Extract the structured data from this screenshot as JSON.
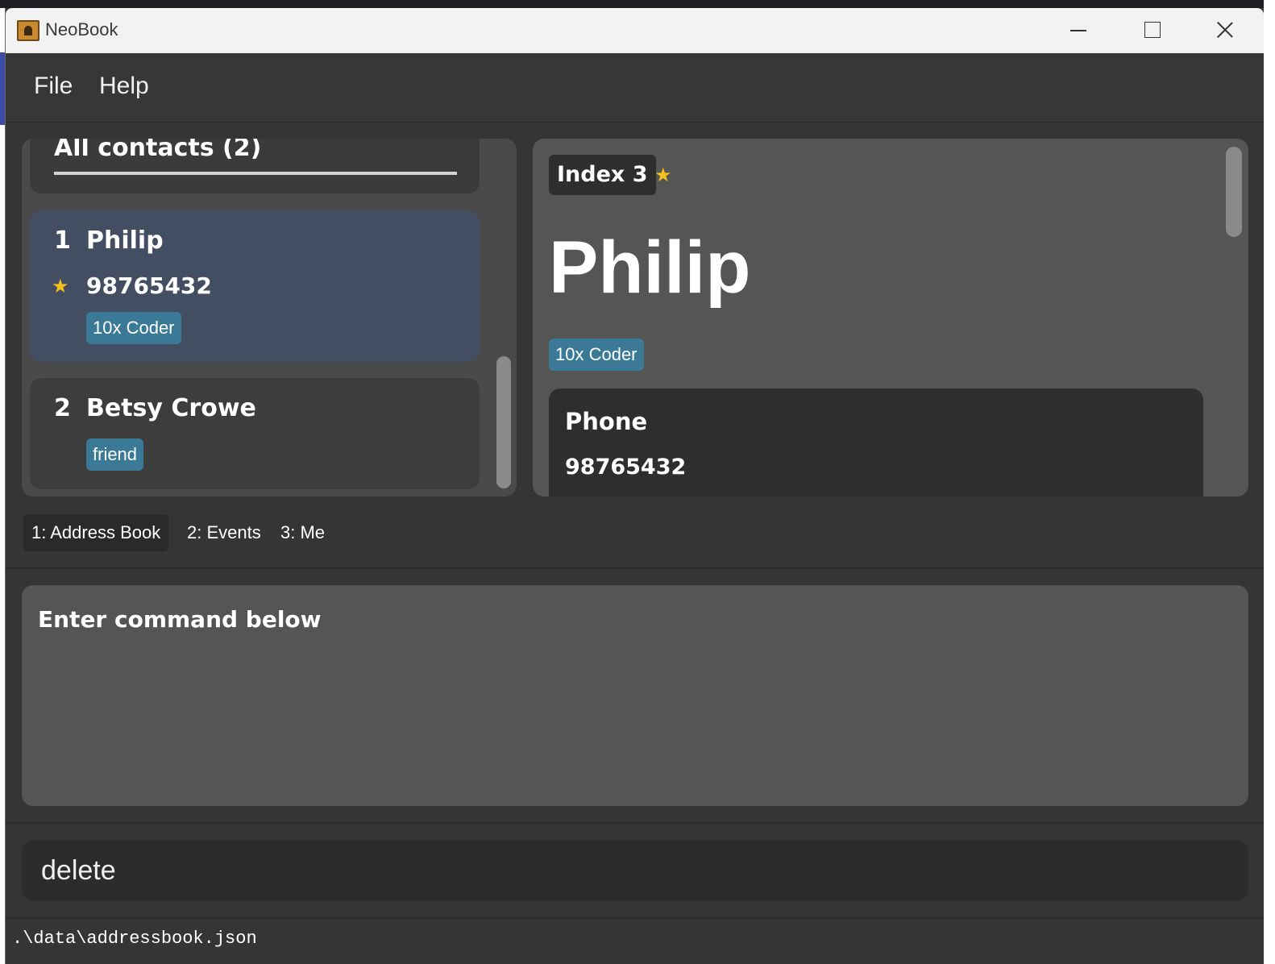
{
  "window": {
    "title": "NeoBook"
  },
  "menu": {
    "file": "File",
    "help": "Help"
  },
  "contact_list": {
    "header": "All contacts (2)",
    "contacts": [
      {
        "index": "1",
        "name": "Philip",
        "favorite": true,
        "phone": "98765432",
        "tags": [
          "10x Coder"
        ],
        "selected": true
      },
      {
        "index": "2",
        "name": "Betsy Crowe",
        "favorite": false,
        "phone": "",
        "tags": [
          "friend"
        ],
        "selected": false
      }
    ]
  },
  "detail": {
    "index_label": "Index 3",
    "favorite": true,
    "name": "Philip",
    "tags": [
      "10x Coder"
    ],
    "phone_label": "Phone",
    "phone_value": "98765432"
  },
  "tabs": [
    {
      "label": "1: Address Book",
      "active": true
    },
    {
      "label": "2: Events",
      "active": false
    },
    {
      "label": "3: Me",
      "active": false
    }
  ],
  "result_display": {
    "text": "Enter command below"
  },
  "command_box": {
    "value": "delete"
  },
  "status_bar": {
    "path": ".\\data\\addressbook.json"
  },
  "icons": {
    "favorite": "star-icon",
    "app": "address-book-icon"
  },
  "colors": {
    "background": "#353535",
    "selected_card": "#434e62",
    "tag": "#3a7a96",
    "star": "#f5bf1f"
  }
}
